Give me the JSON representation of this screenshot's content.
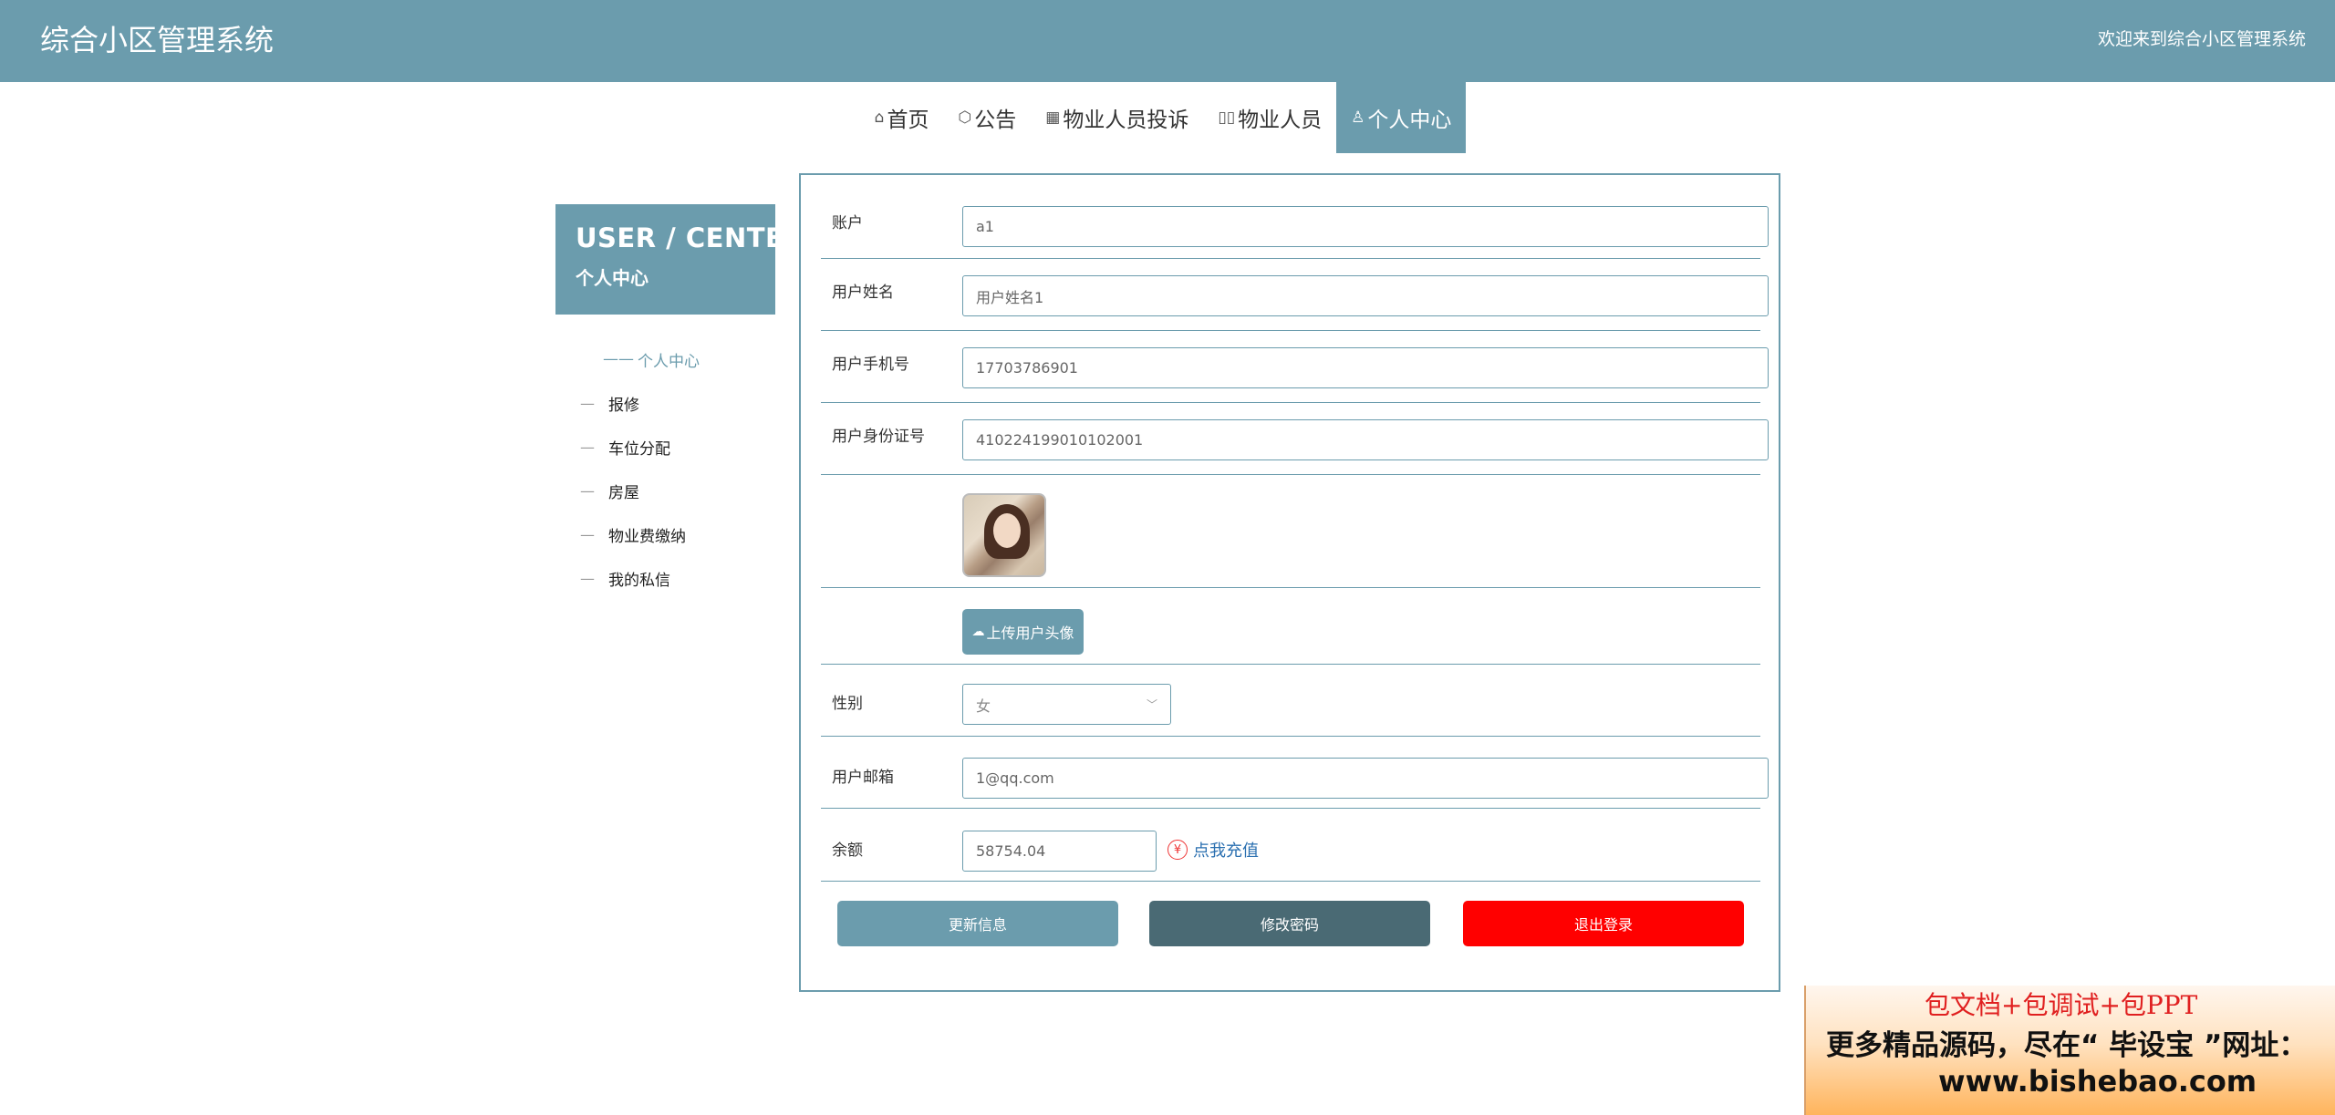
{
  "header": {
    "title": "综合小区管理系统",
    "welcome": "欢迎来到综合小区管理系统"
  },
  "nav": {
    "items": [
      {
        "icon": "⌂",
        "label": "首页"
      },
      {
        "icon": "⬡",
        "label": "公告"
      },
      {
        "icon": "▦",
        "label": "物业人员投诉"
      },
      {
        "icon": "▯▯",
        "label": "物业人员"
      },
      {
        "icon": "♙",
        "label": "个人中心"
      }
    ],
    "active_index": 4
  },
  "sidebar": {
    "banner_en": "USER / CENTER",
    "banner_cn": "个人中心",
    "items": [
      {
        "dash": "——",
        "label": "个人中心"
      },
      {
        "dash": "—",
        "label": "报修"
      },
      {
        "dash": "—",
        "label": "车位分配"
      },
      {
        "dash": "—",
        "label": "房屋"
      },
      {
        "dash": "—",
        "label": "物业费缴纳"
      },
      {
        "dash": "—",
        "label": "我的私信"
      }
    ]
  },
  "form": {
    "account": {
      "label": "账户",
      "value": "a1"
    },
    "name": {
      "label": "用户姓名",
      "value": "用户姓名1"
    },
    "phone": {
      "label": "用户手机号",
      "value": "17703786901"
    },
    "idcard": {
      "label": "用户身份证号",
      "value": "410224199010102001"
    },
    "upload_label": "上传用户头像",
    "gender": {
      "label": "性别",
      "value": "女",
      "arrow": "﹀"
    },
    "email": {
      "label": "用户邮箱",
      "value": "1@qq.com"
    },
    "balance": {
      "label": "余额",
      "value": "58754.04",
      "recharge_icon": "¥",
      "recharge_label": "点我充值"
    },
    "buttons": {
      "update": "更新信息",
      "password": "修改密码",
      "logout": "退出登录"
    }
  },
  "ad": {
    "line1": "包文档+包调试+包PPT",
    "line2": "更多精品源码，尽在“ 毕设宝 ”网址：",
    "line3": "www.bishebao.com"
  },
  "colors": {
    "primary": "#6b9cad",
    "dark": "#4a6a74",
    "danger": "#ff0000"
  }
}
